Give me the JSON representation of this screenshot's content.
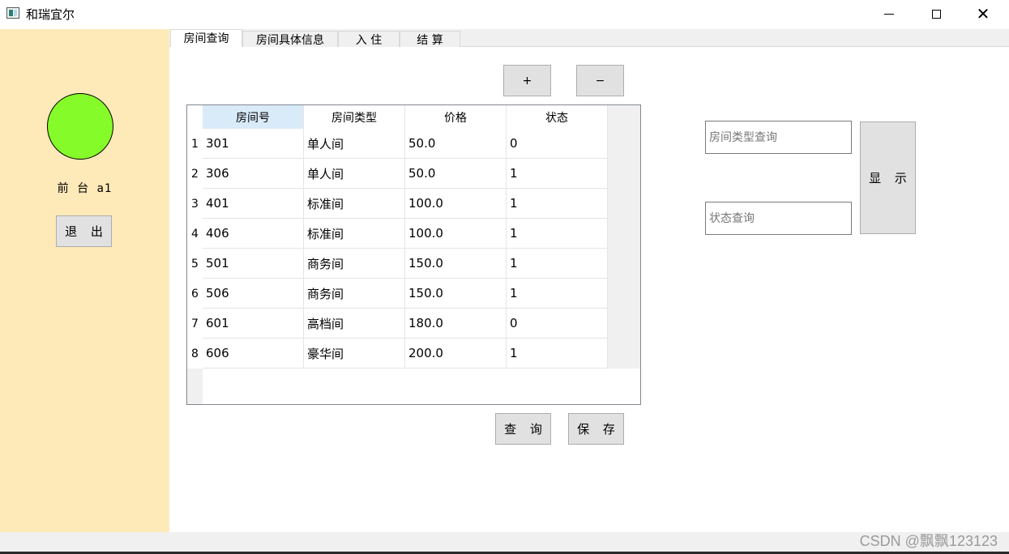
{
  "window": {
    "title": "和瑞宜尔",
    "minimize_glyph": "",
    "maximize_glyph": "",
    "close_glyph": "✕"
  },
  "left_panel": {
    "avatar_color": "#85fc2a",
    "background_color": "#fee9b8",
    "user_label": "前 台 a1",
    "exit_label": "退 出"
  },
  "tabs": [
    {
      "label": "房间查询",
      "active": true
    },
    {
      "label": "房间具体信息",
      "active": false
    },
    {
      "label": "入  住",
      "active": false
    },
    {
      "label": "结  算",
      "active": false
    }
  ],
  "toolbar": {
    "add_label": "+",
    "remove_label": "−"
  },
  "table": {
    "columns": [
      "房间号",
      "房间类型",
      "价格",
      "状态"
    ],
    "rows": [
      {
        "num": "1",
        "cells": [
          "301",
          "单人间",
          "50.0",
          "0"
        ]
      },
      {
        "num": "2",
        "cells": [
          "306",
          "单人间",
          "50.0",
          "1"
        ]
      },
      {
        "num": "3",
        "cells": [
          "401",
          "标准间",
          "100.0",
          "1"
        ]
      },
      {
        "num": "4",
        "cells": [
          "406",
          "标准间",
          "100.0",
          "1"
        ]
      },
      {
        "num": "5",
        "cells": [
          "501",
          "商务间",
          "150.0",
          "1"
        ]
      },
      {
        "num": "6",
        "cells": [
          "506",
          "商务间",
          "150.0",
          "1"
        ]
      },
      {
        "num": "7",
        "cells": [
          "601",
          "高档间",
          "180.0",
          "0"
        ]
      },
      {
        "num": "8",
        "cells": [
          "606",
          "豪华间",
          "200.0",
          "1"
        ]
      }
    ]
  },
  "actions": {
    "query_label": "查 询",
    "save_label": "保 存"
  },
  "search": {
    "type_placeholder": "房间类型查询",
    "type_value": "",
    "status_placeholder": "状态查询",
    "status_value": "",
    "show_label": "显 示"
  },
  "watermark": "CSDN @飘飘123123"
}
